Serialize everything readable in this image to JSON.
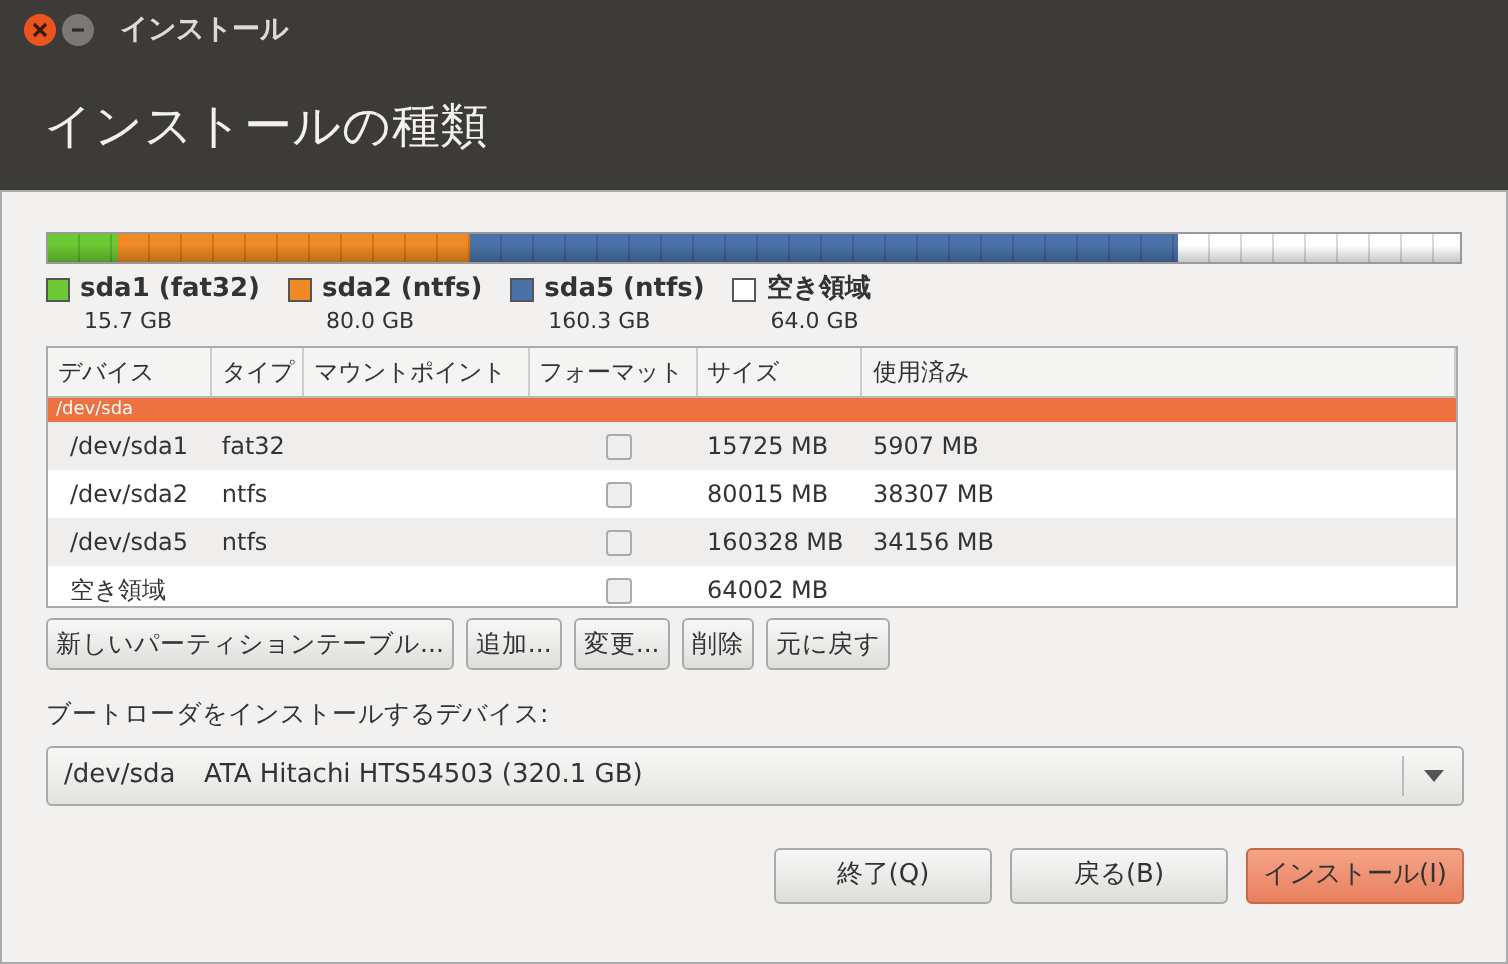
{
  "window": {
    "title": "インストール"
  },
  "header": {
    "title": "インストールの種類"
  },
  "disk_bar": {
    "segments": [
      {
        "name": "sda1 (fat32)",
        "size": "15.7 GB",
        "color": "#6cc833"
      },
      {
        "name": "sda2 (ntfs)",
        "size": "80.0 GB",
        "color": "#f08a24"
      },
      {
        "name": "sda5 (ntfs)",
        "size": "160.3 GB",
        "color": "#4a72a8"
      },
      {
        "name": "空き領域",
        "size": "64.0 GB",
        "color": "#ffffff"
      }
    ]
  },
  "table": {
    "columns": [
      "デバイス",
      "タイプ",
      "マウントポイント",
      "フォーマット",
      "サイズ",
      "使用済み"
    ],
    "rows": [
      {
        "kind": "disk",
        "device": "/dev/sda",
        "selected": true
      },
      {
        "kind": "partition",
        "device": "/dev/sda1",
        "type": "fat32",
        "format": false,
        "size": "15725 MB",
        "used": "5907 MB",
        "selected": false
      },
      {
        "kind": "partition",
        "device": "/dev/sda2",
        "type": "ntfs",
        "format": false,
        "size": "80015 MB",
        "used": "38307 MB",
        "selected": false
      },
      {
        "kind": "partition",
        "device": "/dev/sda5",
        "type": "ntfs",
        "format": false,
        "size": "160328 MB",
        "used": "34156 MB",
        "selected": false
      },
      {
        "kind": "partition",
        "device": "空き領域",
        "format": false,
        "size": "64002 MB",
        "selected": false
      }
    ]
  },
  "table_buttons": [
    "新しいパーティションテーブル...",
    "追加...",
    "変更...",
    "削除",
    "元に戻す"
  ],
  "bootloader": {
    "label": "ブートローダをインストールするデバイス:",
    "device": "/dev/sda",
    "description": "ATA Hitachi HTS54503 (320.1 GB)"
  },
  "buttons": [
    {
      "label": "終了(Q)",
      "primary": false
    },
    {
      "label": "戻る(B)",
      "primary": false
    },
    {
      "label": "インストール(I)",
      "primary": true
    }
  ]
}
